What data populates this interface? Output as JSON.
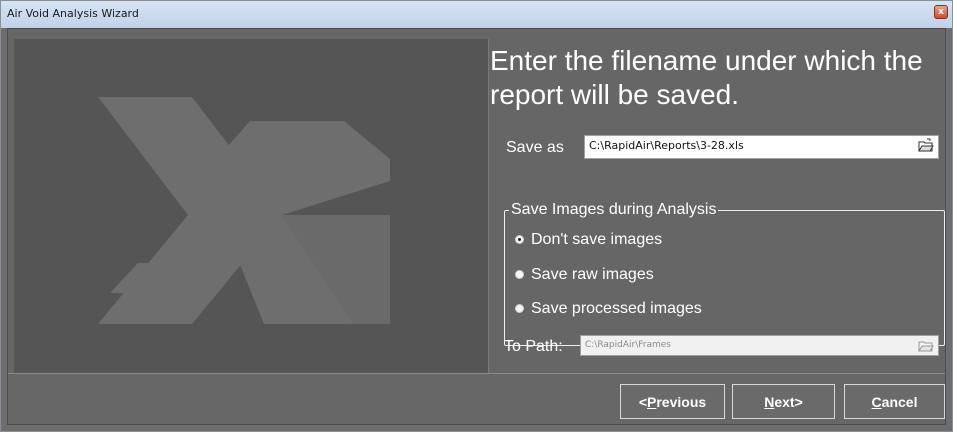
{
  "window": {
    "title": "Air Void Analysis Wizard",
    "close_label": "x"
  },
  "main": {
    "heading": "Enter the filename under which the report will be saved.",
    "save_as": {
      "label": "Save as",
      "value": "C:\\RapidAir\\Reports\\3-28.xls"
    },
    "group": {
      "legend": "Save Images during Analysis",
      "options": [
        {
          "label": "Don't save images",
          "checked": true
        },
        {
          "label": "Save raw images",
          "checked": false
        },
        {
          "label": "Save processed images",
          "checked": false
        }
      ]
    },
    "to_path": {
      "label": "To Path:",
      "value": "C:\\RapidAir\\Frames"
    }
  },
  "buttons": {
    "previous": {
      "prefix": "< ",
      "mnemonic": "P",
      "rest": "revious"
    },
    "next": {
      "prefix": "",
      "mnemonic": "N",
      "rest": "ext>"
    },
    "cancel": {
      "prefix": "",
      "mnemonic": "C",
      "rest": "ancel"
    }
  },
  "icons": {
    "logo": "x-logo-icon",
    "browse": "folder-open-icon",
    "close": "close-icon"
  },
  "colors": {
    "background": "#666666",
    "panel": "#555555",
    "logo": "#6e6e6e",
    "text": "#ffffff"
  }
}
